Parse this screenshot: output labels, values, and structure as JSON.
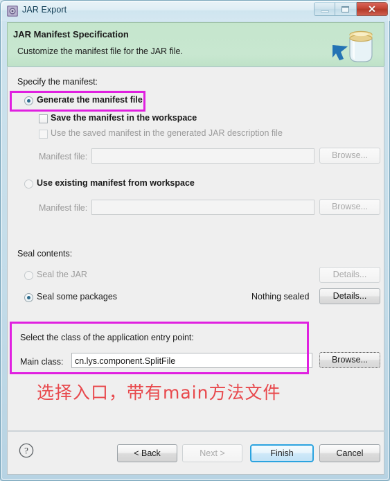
{
  "window": {
    "title": "JAR Export",
    "title_icon": "jar-export-icon",
    "minimize_label": "",
    "maximize_label": "",
    "close_label": "✕"
  },
  "banner": {
    "title": "JAR Manifest Specification",
    "subtitle": "Customize the manifest file for the JAR file.",
    "icon": "jar-jar-banner-icon",
    "bg_color": "#c7e7cf"
  },
  "manifest_section": {
    "group_label": "Specify the manifest:",
    "generate_radio": {
      "label": "Generate the manifest file",
      "selected": true
    },
    "save_checkbox": {
      "label": "Save the manifest in the workspace",
      "checked": false,
      "enabled": true
    },
    "use_saved_checkbox": {
      "label": "Use the saved manifest in the generated JAR description file",
      "checked": false,
      "enabled": false
    },
    "generate_manifest_file": {
      "label": "Manifest file:",
      "value": "",
      "placeholder": "",
      "browse_label": "Browse...",
      "enabled": false
    },
    "existing_radio": {
      "label": "Use existing manifest from workspace",
      "selected": false
    },
    "existing_manifest_file": {
      "label": "Manifest file:",
      "value": "",
      "placeholder": "",
      "browse_label": "Browse...",
      "enabled": false
    }
  },
  "seal_section": {
    "group_label": "Seal contents:",
    "seal_jar_radio": {
      "label": "Seal the JAR",
      "selected": false,
      "enabled": false
    },
    "seal_jar_details": {
      "label": "Details...",
      "enabled": false
    },
    "seal_packages_radio": {
      "label": "Seal some packages",
      "selected": true,
      "enabled": true
    },
    "seal_packages_status": "Nothing sealed",
    "seal_packages_details": {
      "label": "Details...",
      "enabled": true
    }
  },
  "entry_point_section": {
    "group_label": "Select the class of the application entry point:",
    "main_class_label": "Main class:",
    "main_class_value": "cn.lys.component.SplitFile",
    "main_class_placeholder": "",
    "browse_label": "Browse..."
  },
  "button_bar": {
    "help_icon": "help-question-icon",
    "back_label": "< Back",
    "next_label": "Next >",
    "next_enabled": false,
    "finish_label": "Finish",
    "finish_is_default": true,
    "cancel_label": "Cancel"
  },
  "annotations": {
    "highlight_color": "#e020e0",
    "note_color": "#e8484c",
    "note_text": "选择入口，带有main方法文件",
    "highlight_1_target": "generate-the-manifest-file-radio",
    "highlight_2_target": "entry-point-group"
  }
}
